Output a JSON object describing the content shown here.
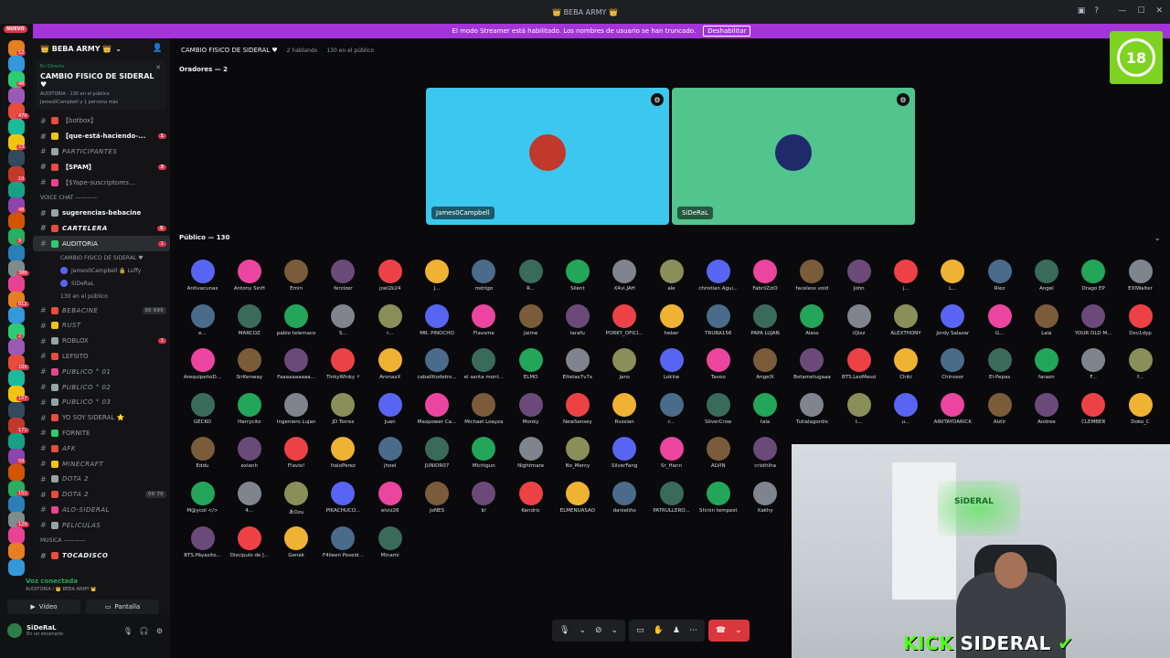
{
  "window": {
    "title": "👑 BEBA ARMY 👑"
  },
  "banner": {
    "text": "El modo Streamer está habilitado. Los nombres de usuario se han truncado.",
    "button": "Deshabilitar"
  },
  "rail": {
    "nuevo": "NUEVO",
    "badges": [
      "52",
      "48",
      "476",
      "23",
      "10",
      "48",
      "9",
      "386",
      "812",
      "2",
      "100",
      "157",
      "171",
      "59",
      "151",
      "129"
    ]
  },
  "server": {
    "name": "👑 BEBA ARMY 👑"
  },
  "live": {
    "label": "En Directo",
    "title": "CAMBIO FISICO DE SIDERAL ♥",
    "sub1": "AUDITORIA · 130 en el público",
    "sub2": "James0Campbell y 1 persona más"
  },
  "channels": [
    {
      "name": "【botbox】",
      "style": ""
    },
    {
      "name": "【que-está-haciendo-...",
      "style": "bold",
      "cnt": "1"
    },
    {
      "name": "PARTICIPANTES",
      "style": "italic"
    },
    {
      "name": "【SPAM】",
      "style": "bold",
      "cnt": "3"
    },
    {
      "name": "【$Yape-suscriptores...",
      "style": ""
    },
    {
      "name": "VOICE CHAT ————",
      "style": "cat"
    },
    {
      "name": "sugerencias-bebacine",
      "style": "bold"
    },
    {
      "name": "CARTELERA",
      "style": "bold italic",
      "cnt": "5"
    },
    {
      "name": "AUDITORIA",
      "style": "active",
      "cnt": "1"
    }
  ],
  "stage_sub": {
    "title": "CAMBIO FISICO DE SIDERAL ♥",
    "users": [
      "James0Campbell 🔒 Luffy",
      "SiDeRaL"
    ],
    "count": "130 en el público"
  },
  "channels2": [
    {
      "name": "BEBACINE",
      "style": "italic",
      "cap": "00 690"
    },
    {
      "name": "RUST",
      "style": "italic"
    },
    {
      "name": "ROBLOX",
      "style": "",
      "cnt": "1"
    },
    {
      "name": "LEFSITO",
      "style": ""
    },
    {
      "name": "PUBLICO ° 01",
      "style": "italic"
    },
    {
      "name": "PUBLICO ° 02",
      "style": "italic"
    },
    {
      "name": "PUBLICO ° 03",
      "style": "italic"
    },
    {
      "name": "YO SOY SIDERAL ⭐",
      "style": ""
    },
    {
      "name": "FORNITE",
      "style": ""
    },
    {
      "name": "AFK",
      "style": "italic"
    },
    {
      "name": "MINECRAFT",
      "style": "italic"
    },
    {
      "name": "DOTA 2",
      "style": "italic"
    },
    {
      "name": "DOTA 2",
      "style": "italic",
      "cap": "00 70"
    },
    {
      "name": "ALO-SIDERAL",
      "style": "italic"
    },
    {
      "name": "PELICULAS",
      "style": "italic"
    },
    {
      "name": "MUSICA ————",
      "style": "cat"
    },
    {
      "name": "TOCADISCO",
      "style": "bold italic"
    }
  ],
  "voice": {
    "status": "Voz conectada",
    "where": "AUDITORIA / 👑 BEBA ARMY 👑",
    "video": "Vídeo",
    "screen": "Pantalla"
  },
  "user": {
    "name": "SiDeRaL",
    "status": "En un escenario"
  },
  "stage": {
    "title": "CAMBIO FISICO DE SIDERAL ♥",
    "speaking": "2 hablando",
    "audience": "130 en el público",
    "speakers_label": "Oradores — 2",
    "audience_label": "Público — 130"
  },
  "speakers": [
    {
      "name": "James0Campbell",
      "bg": "#3cc8ee"
    },
    {
      "name": "SiDeRaL",
      "bg": "#52c48d"
    }
  ],
  "audience": [
    [
      "Antivacunas",
      "Antony SinH",
      "Emin",
      "ferzizer",
      "joel2k24",
      "J...",
      "rodrigo",
      "R...",
      "Silent",
      "X4vi.JAH",
      "ale",
      "christian Agui...",
      "FabriiZziO",
      "faceless void",
      "John",
      "j...",
      "L...",
      "Riez",
      "Angel",
      "Drago EP",
      "EXIWalter"
    ],
    [
      "e...",
      "MARCOZ",
      "pablo telemaco",
      "S...",
      "r...",
      "MR. PINOCHO",
      "Flavsme",
      "Jaime",
      "larafu",
      "PORKY_OFICI...",
      "heber",
      "TRUBA156",
      "PAPA LUJAN",
      "Aless",
      "iQixz",
      "ALEXTHONY",
      "Jordy Salazar",
      "G...",
      "Laia",
      "YOUR OLD M...",
      "Dxv1dyp"
    ],
    [
      "ArequipeñoD...",
      "SirKenway",
      "Faaaaaaaaaa...",
      "TinkyWinky ⚡",
      "AronaxX",
      "caballitodetro...",
      "el santa mont...",
      "ELMO",
      "Eltetas7v7x",
      "Jans",
      "Lokiiw",
      "Tavoo",
      "AngelX",
      "Botametugaaa",
      "BTS.LeoMessi",
      "Chiki",
      "Chinosor",
      "El-Pepas",
      "faraon",
      "F...",
      "f..."
    ],
    [
      "GECKO",
      "Harrycito",
      "Ingeniero Lujan",
      "JD Torres",
      "Juan",
      "Maxpower Ca...",
      "Michael Loayza",
      "Monky",
      "NewSensey",
      "Rvssian",
      "r...",
      "SilverCrow",
      "tala",
      "Tutialagordis",
      "t...",
      "u...",
      "AIRITAYDARICK",
      "Alzlir",
      "Andree",
      "CLEMBER",
      "Doko_C"
    ],
    [
      "Eddu",
      "exianh",
      "Flavio!",
      "ItaloPérez",
      "jhoel",
      "JUNIOR07",
      "Michigun",
      "Nightmare",
      "No_Mercy",
      "SilverFang",
      "Sr_Hann",
      "ALVIN",
      "cristhiha"
    ],
    [
      "M@ycol </>",
      "4...",
      "あOzu",
      "PIKACHUCO...",
      "elviz26",
      "JoNES",
      "b!",
      "Kendric",
      "ELMENUASAO",
      "danieliño",
      "PATRULLERO...",
      "Shinin tempest",
      "Xakhy"
    ],
    [
      "BTS.Påyasito...",
      "Discípulo de J...",
      "Genek",
      "F4ileen Poseid...",
      "Minami"
    ]
  ],
  "colors": {
    "discord_blurple": "#5865f2",
    "discord_red": "#ed4245",
    "discord_green": "#23a55a",
    "discord_pink": "#eb459f",
    "discord_orange": "#f0b232",
    "discord_grey": "#80848e",
    "streamer_banner": "#a335d8"
  },
  "age_badge": "18",
  "overlay": {
    "kick": "KICK",
    "name": "SIDERAL",
    "sign": "SiDERAL"
  }
}
